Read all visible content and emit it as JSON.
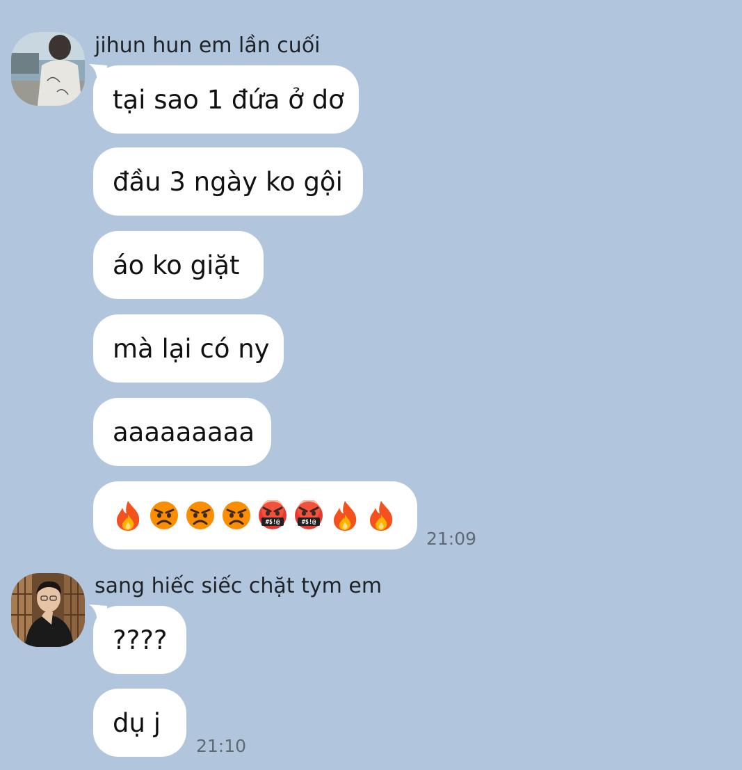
{
  "groups": [
    {
      "sender": "jihun hun em lần cuối",
      "messages": [
        "tại sao 1 đứa ở dơ",
        "đầu 3 ngày ko gội",
        "áo ko giặt",
        "mà lại có ny",
        "aaaaaaaaa"
      ],
      "emoji_message": {
        "emojis": [
          "fire-icon",
          "angry-face-icon",
          "angry-face-icon",
          "angry-face-icon",
          "cursing-face-icon",
          "cursing-face-icon",
          "fire-icon",
          "fire-icon"
        ],
        "cursing_symbols": "#$!@"
      },
      "time": "21:09"
    },
    {
      "sender": "sang hiếc siếc chặt tym em",
      "messages": [
        "????",
        "dụ j"
      ],
      "time": "21:10"
    }
  ],
  "colors": {
    "background": "#b1c6dc",
    "bubble": "#ffffff",
    "time_text": "#5f6a75"
  }
}
